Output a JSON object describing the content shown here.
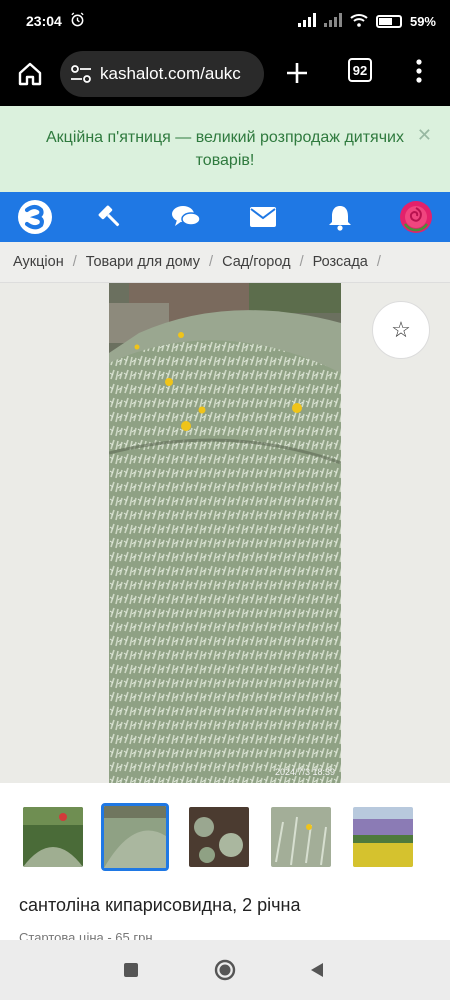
{
  "status_bar": {
    "time": "23:04",
    "battery_percent": "59%",
    "battery_level": 0.59
  },
  "browser": {
    "url": "kashalot.com/aukc",
    "tabs_count": "92"
  },
  "promo": {
    "text": "Акційна п'ятниця — великий розпродаж дитячих товарів!",
    "close_label": "✕"
  },
  "nav": {
    "items": [
      {
        "icon": "kashalot-logo-icon"
      },
      {
        "icon": "gavel-icon"
      },
      {
        "icon": "chat-icon"
      },
      {
        "icon": "mail-icon"
      },
      {
        "icon": "bell-icon"
      },
      {
        "icon": "avatar-rose-icon"
      }
    ]
  },
  "breadcrumb": {
    "items": [
      "Аукціон",
      "Товари для дому",
      "Сад/город",
      "Розсада"
    ],
    "separator": "/"
  },
  "gallery": {
    "photo_timestamp": "2024/7/3 18:39",
    "favorite_icon": "☆"
  },
  "listing": {
    "title": "сантоліна кипарисовидна, 2 річна",
    "price_line": "Стартова ціна - 65 грн"
  },
  "colors": {
    "brand_blue": "#1f78e4",
    "promo_bg": "#dbf1dd",
    "promo_text": "#2f7a3e"
  }
}
